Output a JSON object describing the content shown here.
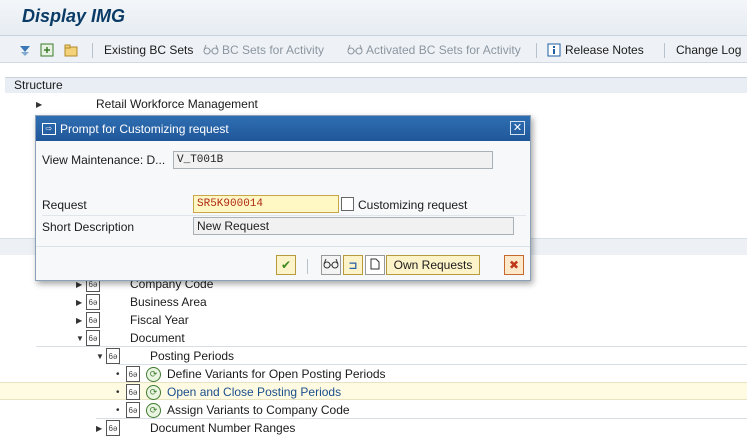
{
  "window": {
    "title": "Display IMG"
  },
  "toolbar": {
    "existing_bc_sets": "Existing BC Sets",
    "bc_sets_for_activity": "BC Sets for Activity",
    "activated_bc_sets_for_activity": "Activated BC Sets for Activity",
    "release_notes": "Release Notes",
    "change_log": "Change Log"
  },
  "structure": {
    "header": "Structure",
    "top_item": "Retail Workforce Management",
    "items": [
      {
        "label": "Company Code"
      },
      {
        "label": "Business Area"
      },
      {
        "label": "Fiscal Year"
      },
      {
        "label": "Document"
      },
      {
        "label": "Posting Periods"
      },
      {
        "label": "Define Variants for Open Posting Periods"
      },
      {
        "label": "Open and Close Posting Periods"
      },
      {
        "label": "Assign Variants to Company Code"
      },
      {
        "label": "Document Number Ranges"
      }
    ]
  },
  "dialog": {
    "title": "Prompt for Customizing request",
    "view_maintenance_label": "View Maintenance: D...",
    "view_maintenance_value": "V_T001B",
    "request_label": "Request",
    "request_value": "SR5K900014",
    "customizing_request_label": "Customizing request",
    "short_description_label": "Short Description",
    "short_description_value": "New Request",
    "own_requests_button": "Own Requests"
  },
  "colors": {
    "title_text": "#0a3b66",
    "dialog_title_bar": "#20579a",
    "active_field_bg": "#fff7c4",
    "active_field_text": "#b02a14",
    "highlight_row": "#fffbe2"
  }
}
